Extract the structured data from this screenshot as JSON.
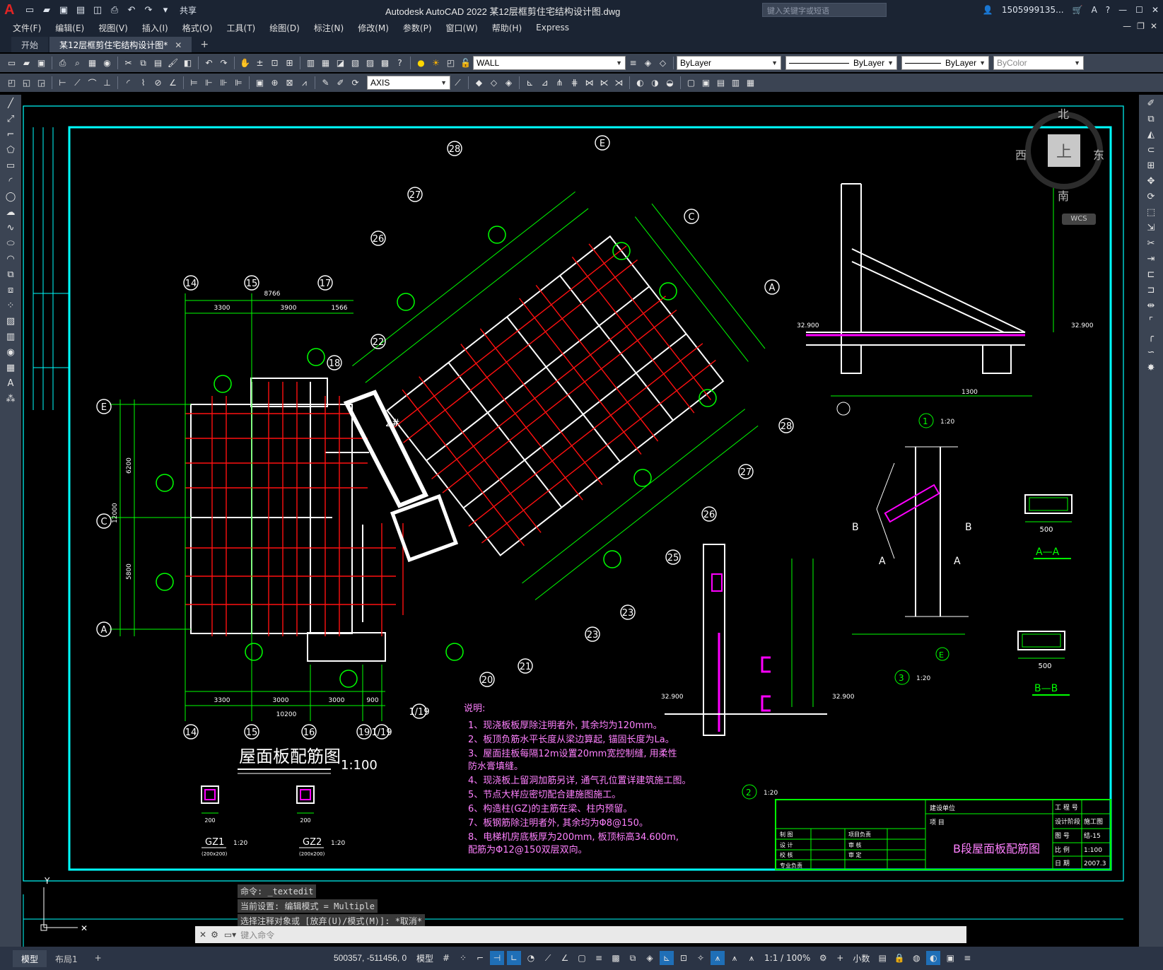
{
  "app": {
    "title": "Autodesk AutoCAD 2022    某12层框剪住宅结构设计图.dwg",
    "search_placeholder": "键入关键字或短语",
    "user": "1505999135...",
    "share_label": "共享"
  },
  "menu": [
    "文件(F)",
    "编辑(E)",
    "视图(V)",
    "插入(I)",
    "格式(O)",
    "工具(T)",
    "绘图(D)",
    "标注(N)",
    "修改(M)",
    "参数(P)",
    "窗口(W)",
    "帮助(H)",
    "Express"
  ],
  "tabs": [
    {
      "label": "开始"
    },
    {
      "label": "某12层框剪住宅结构设计图*"
    }
  ],
  "toolbar": {
    "layer": "WALL",
    "color": "ByLayer",
    "linetype": "ByLayer",
    "lineweight": "ByLayer",
    "plotstyle": "ByColor",
    "dimstyle": "AXIS"
  },
  "viewcube": {
    "north": "北",
    "south": "南",
    "east": "东",
    "west": "西",
    "top": "上",
    "wcs": "WCS"
  },
  "drawing": {
    "main_title": "屋面板配筋图",
    "main_scale": "1:100",
    "notes_title": "说明:",
    "notes": [
      "1、现浇板板厚除注明者外, 其余均为120mm。",
      "2、板顶负筋水平长度从梁边算起, 锚固长度为La。",
      "3、屋面挂板每隔12m设置20mm宽控制缝, 用柔性",
      "   防水膏填缝。",
      "4、现浇板上留洞加筋另详, 通气孔位置详建筑施工图。",
      "5、节点大样应密切配合建施图施工。",
      "6、构造柱(GZ)的主筋在梁、柱内预留。",
      "7、板钢筋除注明者外, 其余均为Φ8@150。",
      "8、电梯机房底板厚为200mm, 板顶标高34.600m,",
      "   配筋为Φ12@150双层双向。"
    ],
    "gz1": "GZ1",
    "gz2": "GZ2",
    "gz_size": "(200x200)",
    "gz_scale": "1:20",
    "section_aa": "A—A",
    "section_bb": "B—B",
    "detail1_scale": "1:20",
    "detail2_scale": "1:20",
    "detail3_scale": "1:20",
    "elev_1": "32.900",
    "titleblock": {
      "drawing_name": "B段屋面板配筋图",
      "project_no_label": "工 程 号",
      "stage_label": "设计阶段",
      "stage_value": "施工图",
      "drawing_no_label": "图 号",
      "drawing_no": "结-15",
      "scale_label": "比 例",
      "scale_value": "1:100",
      "date_label": "日 期",
      "date_value": "2007.3",
      "client_label": "建设单位",
      "project_label": "项 目",
      "roles": [
        "制 图",
        "设 计",
        "校 核",
        "专业负责"
      ],
      "roles2": [
        "项目负责",
        "审 核",
        "审 定"
      ]
    }
  },
  "command": {
    "history": [
      "命令: _textedit",
      "当前设置: 编辑模式 = Multiple",
      "选择注释对象或 [放弃(U)/模式(M)]: *取消*"
    ],
    "placeholder": "键入命令"
  },
  "status": {
    "layout_tabs": [
      "模型",
      "布局1"
    ],
    "coords": "500357, -511456, 0",
    "model": "模型",
    "scale": "1:1 / 100%",
    "units": "小数"
  }
}
